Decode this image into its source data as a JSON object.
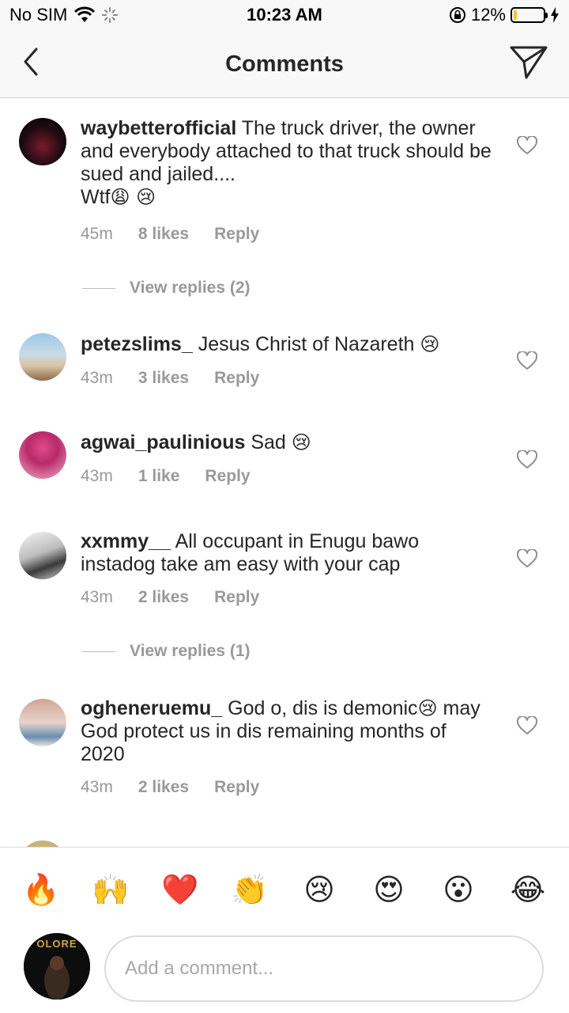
{
  "status_bar": {
    "carrier": "No SIM",
    "time": "10:23 AM",
    "battery_percent": "12%",
    "battery_level": 0.12
  },
  "nav": {
    "title": "Comments",
    "back_icon": "chevron-left-icon",
    "send_icon": "paper-plane-icon"
  },
  "comments": [
    {
      "username": "waybetterofficial",
      "text": "The truck driver, the owner and everybody attached to that truck should be sued and jailed....",
      "text_line2": "Wtf",
      "emoji": "😩 😢",
      "time": "45m",
      "likes": "8 likes",
      "reply": "Reply",
      "view_replies": "View replies (2)"
    },
    {
      "username": "petezslims_",
      "text": "Jesus Christ of Nazareth",
      "emoji": "😢",
      "time": "43m",
      "likes": "3 likes",
      "reply": "Reply"
    },
    {
      "username": "agwai_paulinious",
      "text": "Sad",
      "emoji": "😢",
      "time": "43m",
      "likes": "1 like",
      "reply": "Reply"
    },
    {
      "username": "xxmmy__",
      "text": "All occupant in Enugu bawo instadog take am easy with your cap",
      "time": "43m",
      "likes": "2 likes",
      "reply": "Reply",
      "view_replies": "View replies (1)"
    },
    {
      "username": "ogheneruemu_",
      "text": "God o, dis is demonic",
      "emoji": "😢",
      "text_rest": "may God protect us in dis remaining months of 2020",
      "time": "43m",
      "likes": "2 likes",
      "reply": "Reply"
    }
  ],
  "emoji_bar": [
    "🔥",
    "🙌",
    "❤️",
    "👏",
    "😢",
    "😍",
    "😮",
    "😂"
  ],
  "composer": {
    "placeholder": "Add a comment...",
    "avatar_text": "OLORE"
  },
  "colors": {
    "text": "#262626",
    "meta": "#999999",
    "divider": "#dbdbdb",
    "battery": "#f4c430"
  }
}
